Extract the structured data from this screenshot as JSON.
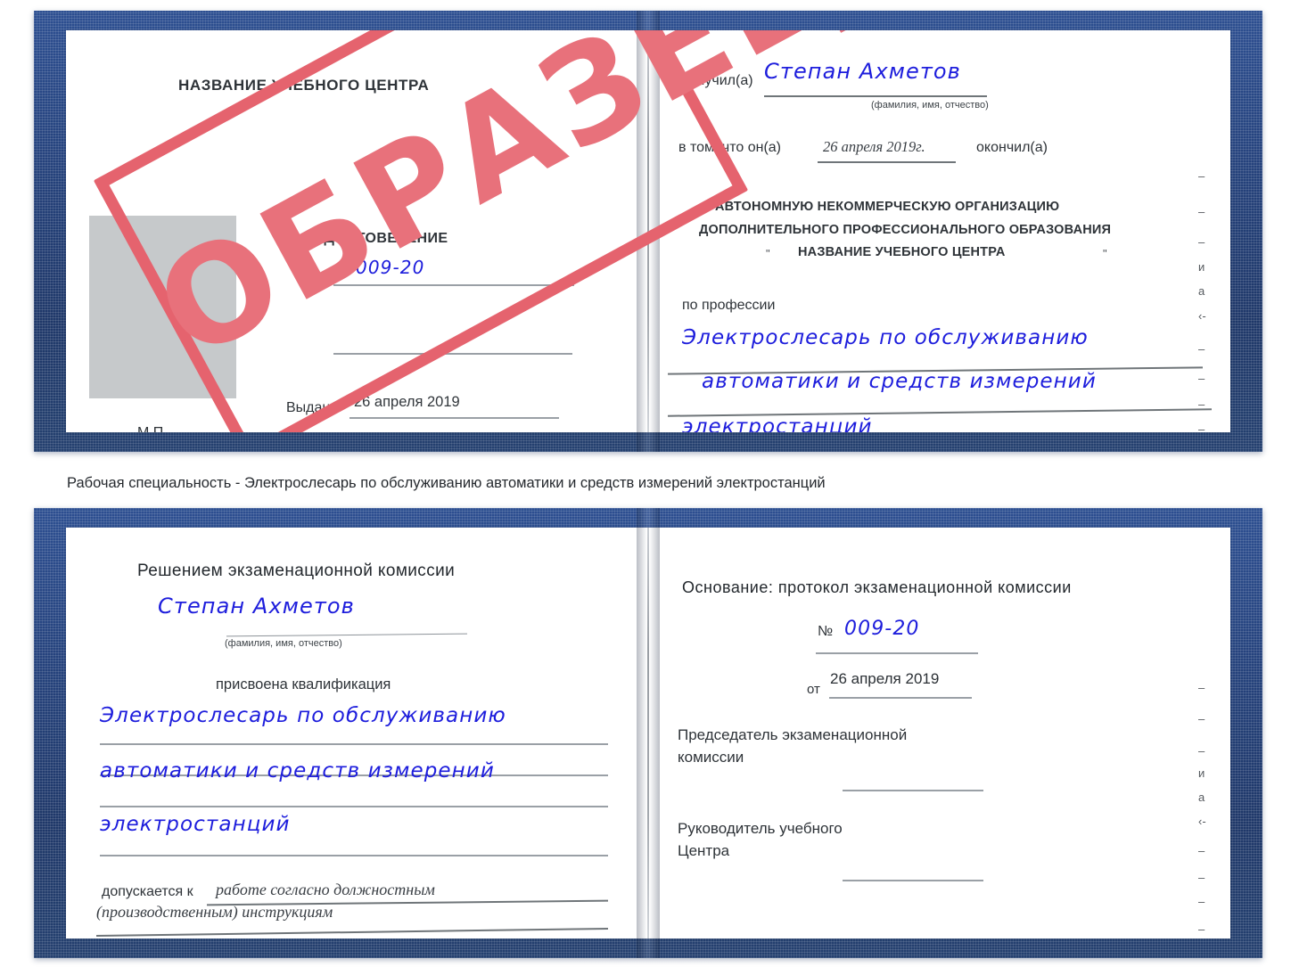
{
  "document": {
    "type": "Удостоверение (свидетельство) о квалификации — образец",
    "stamp_label": "ОБРАЗЕЦ",
    "accent_blue": "#25427c",
    "stamp_red": "#e5636e",
    "handwriting_blue": "#1d1ddc",
    "photo_placeholder_color": "#c6c9cb"
  },
  "caption": {
    "text": "Рабочая специальность - Электрослесарь по обслуживанию автоматики и средств измерений электростанций"
  },
  "cert_top": {
    "left_page": {
      "header": "НАЗВАНИЕ УЧЕБНОГО ЦЕНТРА",
      "title": "УДОСТОВЕРЕНИЕ",
      "number_label": "№",
      "number_value": "009-20",
      "issued_label": "Выдано",
      "issued_value": "26 апреля 2019",
      "seal_label": "М.П."
    },
    "right_page": {
      "received_label": "Получил(а)",
      "received_value": "Степан Ахметов",
      "fio_hint": "(фамилия, имя, отчество)",
      "that_he_label": "в том, что он(а)",
      "completion_date": "26 апреля 2019г.",
      "finished_label": "окончил(а)",
      "org_line1": "АВТОНОМНУЮ НЕКОММЕРЧЕСКУЮ ОРГАНИЗАЦИЮ",
      "org_line2": "ДОПОЛНИТЕЛЬНОГО ПРОФЕССИОНАЛЬНОГО ОБРАЗОВАНИЯ",
      "org_quote_open": "\"",
      "org_line3": "НАЗВАНИЕ УЧЕБНОГО ЦЕНТРА",
      "org_quote_close": "\"",
      "profession_label": "по профессии",
      "profession_line1": "Электрослесарь по обслуживанию",
      "profession_line2": "автоматики и средств измерений",
      "profession_line3": "электростанций",
      "edge_marks": [
        "–",
        "–",
        "–",
        "и",
        "а",
        "‹-",
        "–",
        "–",
        "–",
        "–"
      ]
    }
  },
  "cert_bottom": {
    "left_page": {
      "header": "Решением экзаменационной комиссии",
      "name_value": "Степан Ахметов",
      "fio_hint": "(фамилия, имя, отчество)",
      "qualification_label": "присвоена квалификация",
      "qualification_line1": "Электрослесарь по обслуживанию",
      "qualification_line2": "автоматики и средств измерений",
      "qualification_line3": "электростанций",
      "admitted_label": "допускается к",
      "admitted_value1": "работе согласно должностным",
      "admitted_value2": "(производственным) инструкциям"
    },
    "right_page": {
      "basis_label": "Основание: протокол экзаменационной комиссии",
      "number_label": "№",
      "number_value": "009-20",
      "from_label": "от",
      "from_value": "26 апреля 2019",
      "chairman_line1": "Председатель экзаменационной",
      "chairman_line2": "комиссии",
      "head_line1": "Руководитель учебного",
      "head_line2": "Центра",
      "edge_marks": [
        "–",
        "–",
        "–",
        "и",
        "а",
        "‹-",
        "–",
        "–",
        "–",
        "–"
      ]
    }
  }
}
